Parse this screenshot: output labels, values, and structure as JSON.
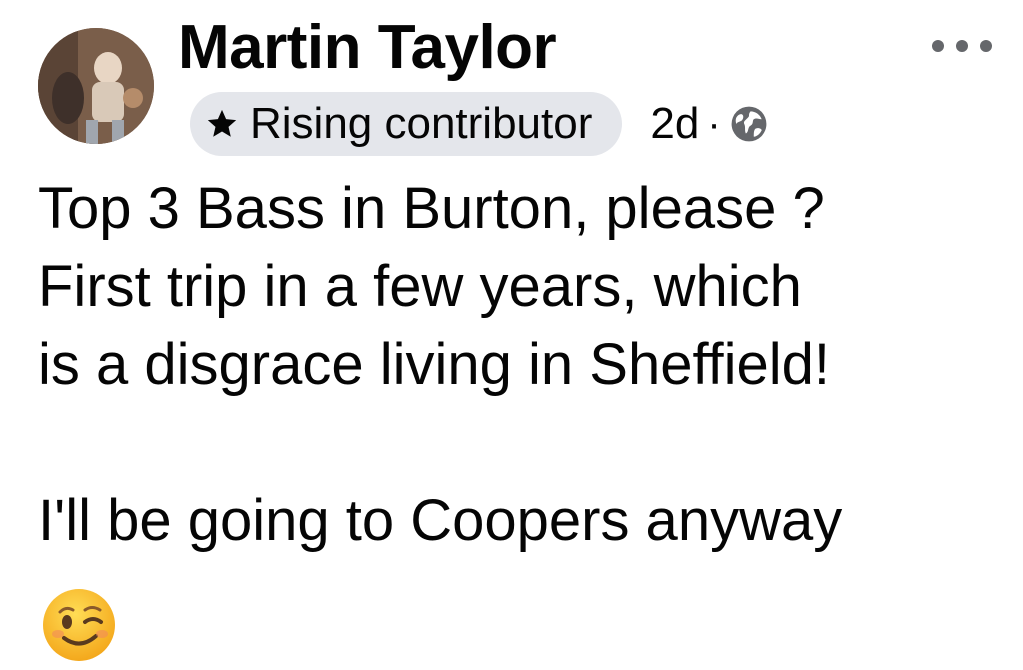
{
  "post": {
    "author_name": "Martin Taylor",
    "badge_label": "Rising contributor",
    "badge_icon": "star-icon",
    "timestamp": "2d",
    "separator": "·",
    "audience_icon": "globe-icon",
    "more_icon": "more-options-icon",
    "text_lines": [
      "Top 3 Bass in Burton, please ?",
      "First trip in a few years, which",
      "is a disgrace living in Sheffield!",
      "",
      "I'll be going to Coopers anyway"
    ],
    "emoji": "winking-face-emoji"
  },
  "colors": {
    "text": "#050505",
    "secondary": "#65676b",
    "badge_bg": "#e4e6eb",
    "background": "#ffffff"
  }
}
